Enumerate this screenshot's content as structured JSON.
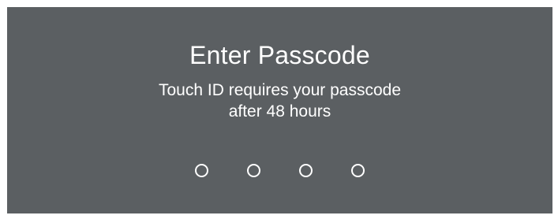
{
  "passcode": {
    "title": "Enter Passcode",
    "message_line1": "Touch ID requires your passcode",
    "message_line2": "after 48 hours",
    "digits_total": 4,
    "digits_entered": 0
  },
  "colors": {
    "background": "#5b5f62",
    "text": "#ffffff",
    "dot_outline": "#ffffff"
  }
}
